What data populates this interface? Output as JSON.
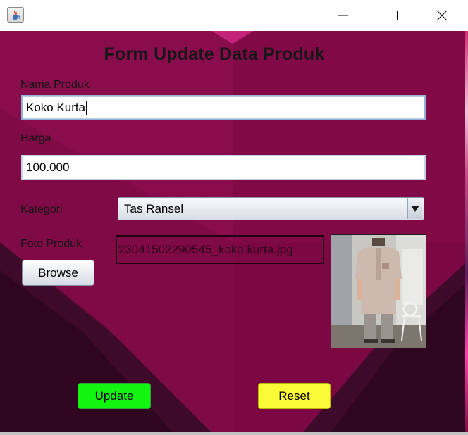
{
  "window": {
    "app_icon": "java-coffee-cup-icon",
    "controls": [
      "minimize-icon",
      "maximize-icon",
      "close-icon"
    ]
  },
  "form": {
    "title": "Form Update Data Produk",
    "nama_produk": {
      "label": "Nama Produk",
      "value": "Koko Kurta"
    },
    "harga": {
      "label": "Harga",
      "value": "100.000"
    },
    "kategori": {
      "label": "Kategori",
      "selected": "Tas Ransel",
      "arrow_icon": "dropdown-arrow-icon"
    },
    "foto": {
      "label": "Foto Produk",
      "browse_label": "Browse",
      "filename": "23041502290545_koko kurta.jpg",
      "image_subject": "man wearing beige koko kurta shirt"
    },
    "buttons": {
      "update_label": "Update",
      "reset_label": "Reset"
    }
  },
  "colors": {
    "background": "#7e0a45",
    "update_button": "#11f511",
    "reset_button": "#fafa36"
  }
}
